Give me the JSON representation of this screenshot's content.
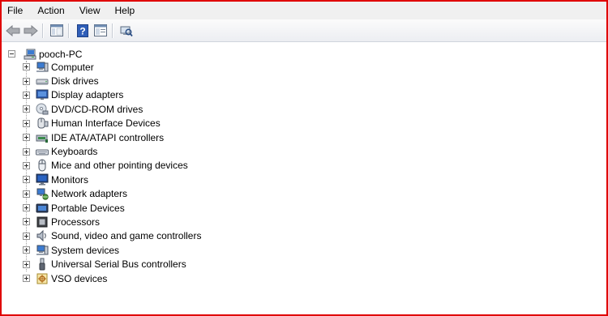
{
  "menu": {
    "file": "File",
    "action": "Action",
    "view": "View",
    "help": "Help"
  },
  "toolbar": {
    "buttons": [
      "back-icon",
      "forward-icon",
      "show-hide-tree-icon",
      "help-icon",
      "properties-icon",
      "scan-hardware-icon"
    ]
  },
  "tree": {
    "root": "pooch-PC",
    "children": [
      {
        "label": "Computer",
        "icon": "computer-icon"
      },
      {
        "label": "Disk drives",
        "icon": "disk-drive-icon"
      },
      {
        "label": "Display adapters",
        "icon": "display-adapter-icon"
      },
      {
        "label": "DVD/CD-ROM drives",
        "icon": "dvd-drive-icon"
      },
      {
        "label": "Human Interface Devices",
        "icon": "hid-icon"
      },
      {
        "label": "IDE ATA/ATAPI controllers",
        "icon": "ide-controller-icon"
      },
      {
        "label": "Keyboards",
        "icon": "keyboard-icon"
      },
      {
        "label": "Mice and other pointing devices",
        "icon": "mouse-icon"
      },
      {
        "label": "Monitors",
        "icon": "monitor-icon"
      },
      {
        "label": "Network adapters",
        "icon": "network-adapter-icon"
      },
      {
        "label": "Portable Devices",
        "icon": "portable-device-icon"
      },
      {
        "label": "Processors",
        "icon": "processor-icon"
      },
      {
        "label": "Sound, video and game controllers",
        "icon": "speaker-icon"
      },
      {
        "label": "System devices",
        "icon": "system-device-icon"
      },
      {
        "label": "Universal Serial Bus controllers",
        "icon": "usb-icon"
      },
      {
        "label": "VSO devices",
        "icon": "vso-device-icon"
      }
    ]
  },
  "colors": {
    "frame_border": "#e00000",
    "menubar_bg": "#f0f0f0"
  }
}
